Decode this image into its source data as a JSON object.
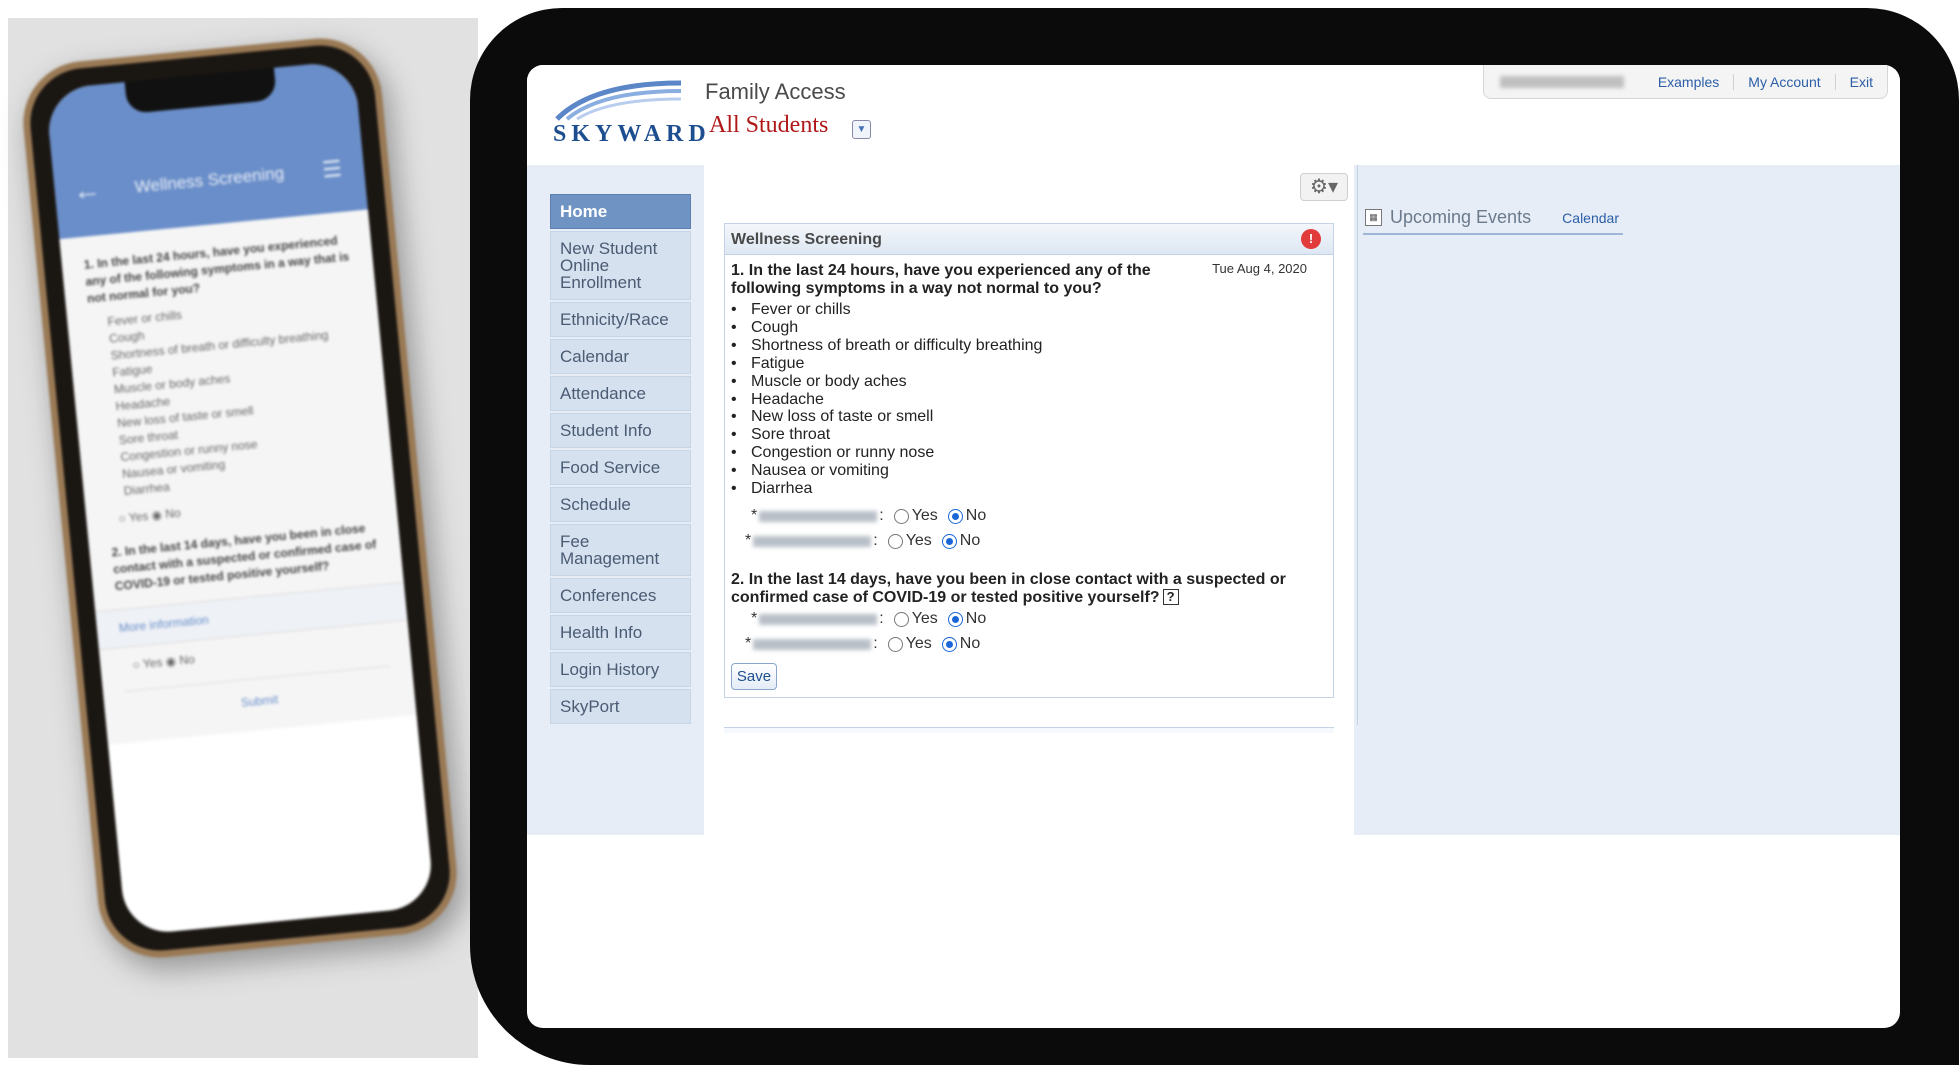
{
  "phone": {
    "title": "Wellness Screening",
    "q1": "1. In the last 24 hours, have you experienced any of the following symptoms in a way that is not normal for you?",
    "symptoms": [
      "Fever or chills",
      "Cough",
      "Shortness of breath or difficulty breathing",
      "Fatigue",
      "Muscle or body aches",
      "Headache",
      "New loss of taste or smell",
      "Sore throat",
      "Congestion or runny nose",
      "Nausea or vomiting",
      "Diarrhea"
    ],
    "yes_no": "○ Yes  ◉ No",
    "q2": "2. In the last 14 days, have you been in close contact with a suspected or confirmed case of COVID-19 or tested positive yourself?",
    "more_info": "More information",
    "submit": "Submit"
  },
  "header": {
    "logo": "SKYWARD",
    "app_title": "Family Access",
    "student_select": "All Students"
  },
  "top_links": [
    "Examples",
    "My Account",
    "Exit"
  ],
  "nav": [
    "Home",
    "New Student Online Enrollment",
    "Ethnicity/Race",
    "Calendar",
    "Attendance",
    "Student Info",
    "Food Service",
    "Schedule",
    "Fee Management",
    "Conferences",
    "Health Info",
    "Login History",
    "SkyPort"
  ],
  "panel": {
    "title": "Wellness Screening",
    "date": "Tue Aug 4, 2020",
    "q1": "1. In the last 24 hours, have you experienced any of the following symptoms in a way not normal to you?",
    "symptoms": [
      "Fever or chills",
      "Cough",
      "Shortness of breath or difficulty breathing",
      "Fatigue",
      "Muscle or body aches",
      "Headache",
      "New loss of taste or smell",
      "Sore throat",
      "Congestion or runny nose",
      "Nausea or vomiting",
      "Diarrhea"
    ],
    "q2": "2. In the last 14 days, have you been in close contact with a suspected or confirmed case of COVID-19 or tested positive yourself?",
    "help": "?",
    "yes_label": "Yes",
    "no_label": "No",
    "selected_answer": "No",
    "save": "Save"
  },
  "events": {
    "title": "Upcoming Events",
    "calendar_link": "Calendar"
  },
  "colors": {
    "accent": "#2c5ea8",
    "nav_active": "#6f93c3",
    "brand_red": "#b01818"
  }
}
